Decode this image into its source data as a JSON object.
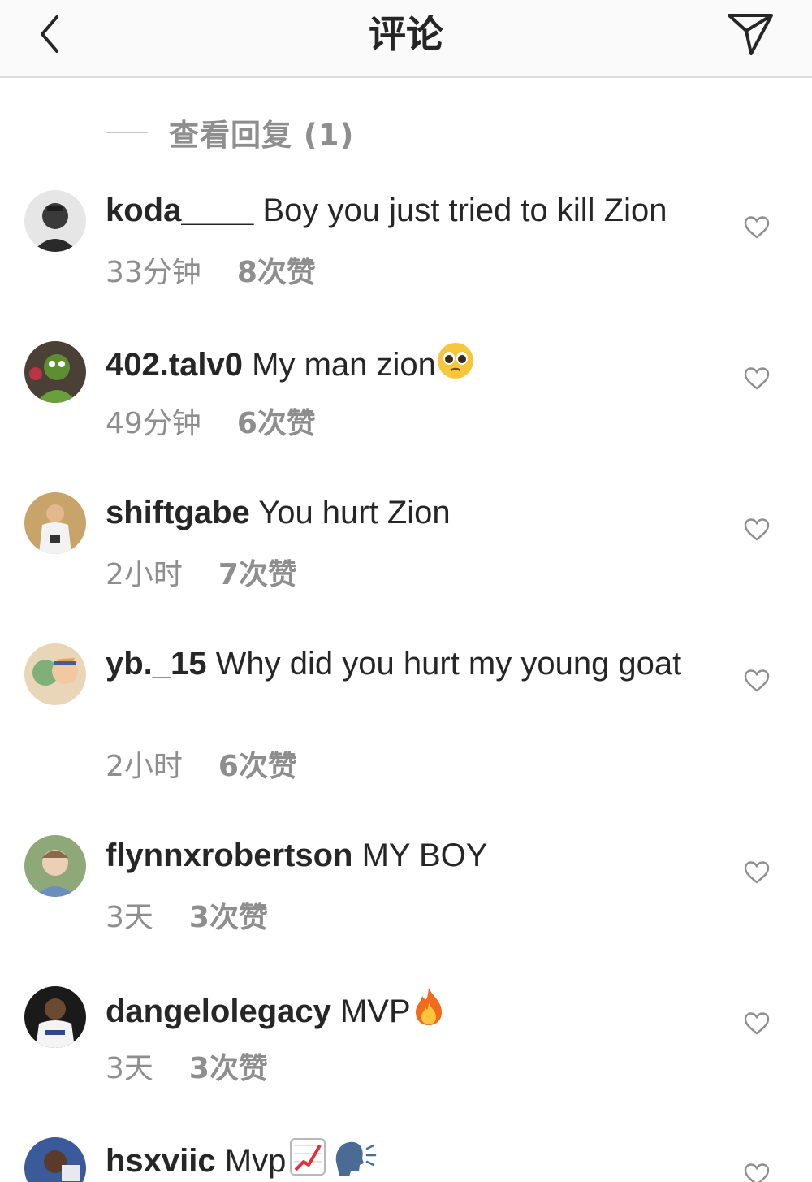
{
  "header": {
    "title": "评论",
    "back_icon": "chevron-left-icon",
    "send_icon": "paper-plane-icon"
  },
  "view_replies": {
    "label": "查看回复 (1)"
  },
  "comments": [
    {
      "username": "koda____",
      "text": " Boy you just tried to kill Zion",
      "time": "33分钟",
      "likes": "8次赞"
    },
    {
      "username": "402.talv0",
      "text": " My man zion",
      "emoji": "pleading-face",
      "time": "49分钟",
      "likes": "6次赞"
    },
    {
      "username": "shiftgabe",
      "text": " You hurt Zion",
      "time": "2小时",
      "likes": "7次赞"
    },
    {
      "username": "yb._15",
      "text": " Why did you hurt my young goat",
      "time": "2小时",
      "likes": "6次赞"
    },
    {
      "username": "flynnxrobertson",
      "text": " MY BOY",
      "time": "3天",
      "likes": "3次赞"
    },
    {
      "username": "dangelolegacy",
      "text": " MVP",
      "emoji": "fire",
      "time": "3天",
      "likes": "3次赞"
    },
    {
      "username": "hsxviic",
      "text": " Mvp",
      "emoji": "chart-increasing speaking-head"
    }
  ],
  "colors": {
    "text": "#262626",
    "secondary": "#8e8e8e",
    "header_bg": "#fafafa",
    "divider": "#dbdbdb"
  }
}
